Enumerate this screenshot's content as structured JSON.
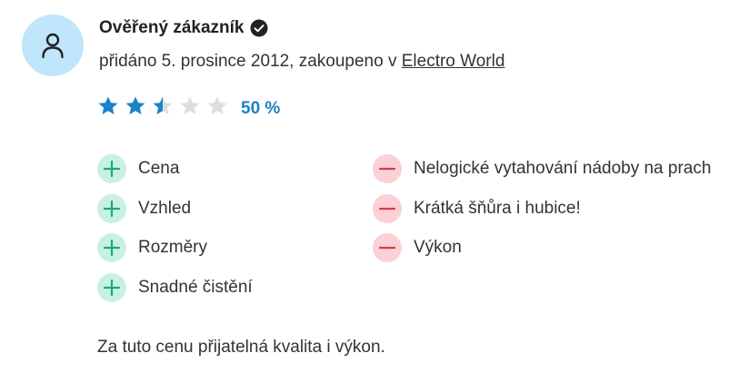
{
  "author": {
    "name": "Ověřený zákazník",
    "verified_icon": "check-circle-icon"
  },
  "meta": {
    "added_prefix": "přidáno 5. prosince 2012, zakoupeno v ",
    "store_link": "Electro World"
  },
  "rating": {
    "stars_filled": 2.5,
    "stars_total": 5,
    "value_text": "50 %",
    "colors": {
      "filled": "#1a82c6",
      "empty": "#dddddd"
    }
  },
  "pros": [
    {
      "label": "Cena"
    },
    {
      "label": "Vzhled"
    },
    {
      "label": "Rozměry"
    },
    {
      "label": "Snadné čistění"
    }
  ],
  "cons": [
    {
      "label": "Nelogické vytahování nádoby na prach"
    },
    {
      "label": "Krátká šňůra i hubice!"
    },
    {
      "label": "Výkon"
    }
  ],
  "summary": "Za tuto cenu přijatelná kvalita i výkon.",
  "colors": {
    "avatar_bg": "#bfe6fb",
    "plus_bg": "#c8f1e4",
    "plus_icon": "#1ea87b",
    "minus_bg": "#fbd0d6",
    "minus_icon": "#d43c4a"
  }
}
